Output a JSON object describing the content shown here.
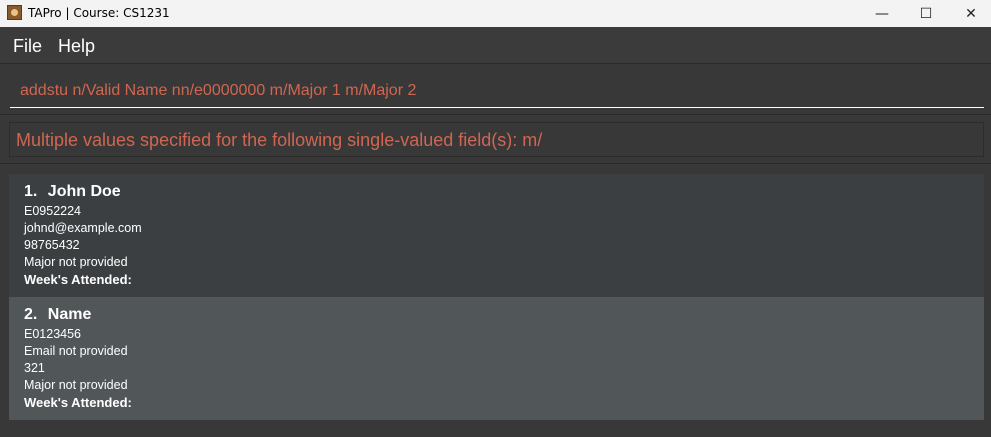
{
  "window": {
    "title": "TAPro | Course: CS1231",
    "minimize_glyph": "—",
    "maximize_glyph": "☐",
    "close_glyph": "✕"
  },
  "menu": {
    "file_label": "File",
    "help_label": "Help"
  },
  "command": {
    "value": "addstu n/Valid Name nn/e0000000 m/Major 1 m/Major 2"
  },
  "result": {
    "message": "Multiple values specified for the following single-valued field(s): m/"
  },
  "students": [
    {
      "index": "1.",
      "name": "John Doe",
      "student_id": "E0952224",
      "email": "johnd@example.com",
      "phone": "98765432",
      "major": "Major not provided",
      "weeks_label": "Week's Attended:"
    },
    {
      "index": "2.",
      "name": "Name",
      "student_id": "E0123456",
      "email": "Email not provided",
      "phone": "321",
      "major": "Major not provided",
      "weeks_label": "Week's Attended:"
    }
  ],
  "colors": {
    "error_text": "#d06651",
    "background": "#383838",
    "card_selected": "#515658"
  }
}
